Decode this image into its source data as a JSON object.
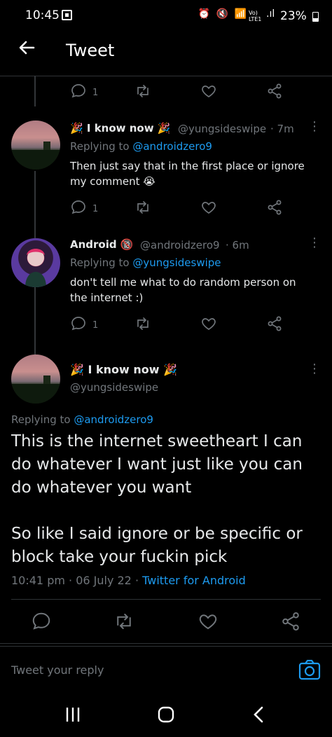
{
  "status": {
    "time": "10:45",
    "signal_text": "Vo) LTE1",
    "battery": "23%"
  },
  "header": {
    "title": "Tweet"
  },
  "top_actions": {
    "reply_count": "1"
  },
  "tweets": [
    {
      "display_name": "🎉 I know now 🎉",
      "handle": "@yungsideswipe",
      "time": "· 7m",
      "replying_label": "Replying to",
      "replying_to": "@androidzero9",
      "text": "Then just say that in the first place  or ignore my comment 😭",
      "reply_count": "1"
    },
    {
      "display_name": "Android 🔞",
      "handle": "@androidzero9",
      "time": "· 6m",
      "replying_label": "Replying to",
      "replying_to": "@yungsideswipe",
      "text": "don't tell me what to do random person on the internet :)",
      "reply_count": "1"
    }
  ],
  "main_tweet": {
    "display_name": "🎉 I know now 🎉",
    "handle": "@yungsideswipe",
    "replying_label": "Replying to",
    "replying_to": "@androidzero9",
    "text_p1": "This is the internet sweetheart I can do whatever I want just like you can do whatever you want",
    "text_p2": "So like I said ignore or be specific or block  take your fuckin pick",
    "timestamp": "10:41 pm · 06 July 22 ·",
    "source": "Twitter for Android"
  },
  "reply_box": {
    "placeholder": "Tweet your reply"
  },
  "colors": {
    "accent": "#1d9bf0",
    "muted": "#71767b",
    "background": "#000000"
  }
}
